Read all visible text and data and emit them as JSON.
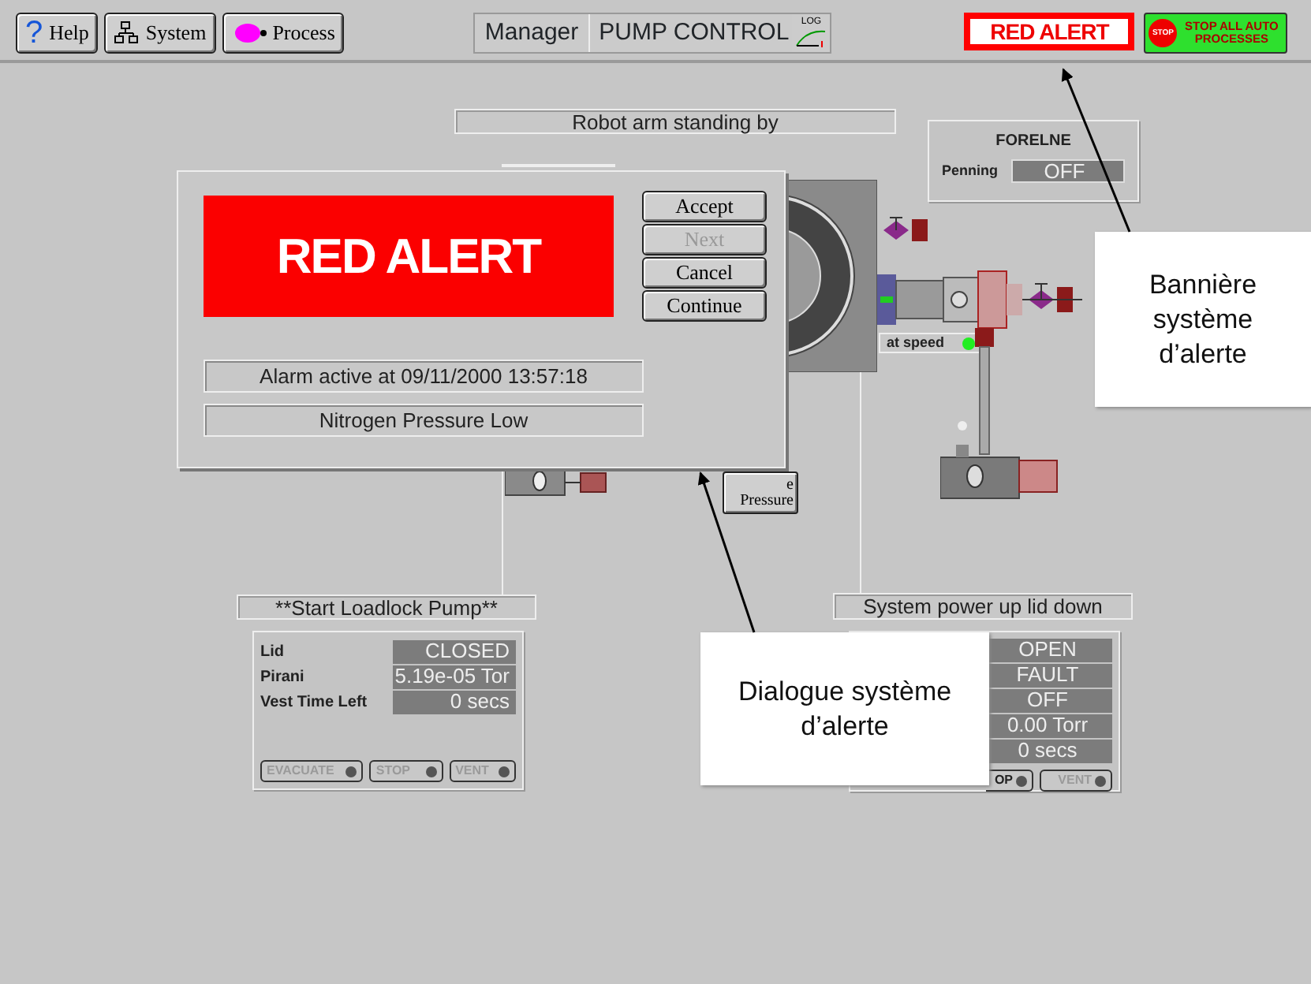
{
  "toolbar": {
    "buttons": [
      {
        "kind": "help",
        "icon_text": "?",
        "label": "Help"
      },
      {
        "kind": "system",
        "label": "System"
      },
      {
        "kind": "process",
        "label": "Process"
      }
    ],
    "manager": {
      "user": "Manager",
      "screen": "PUMP CONTROL",
      "log_label": "LOG"
    },
    "alert_banner": {
      "text": "RED ALERT",
      "active": true
    },
    "stop_button": {
      "icon_text": "STOP",
      "label": "STOP ALL AUTO PROCESSES"
    }
  },
  "canvas": {
    "status": "Robot arm standing by",
    "foreline": {
      "title": "FORELNE",
      "rows": [
        {
          "label": "Penning",
          "value": "OFF"
        }
      ]
    },
    "turbo": {
      "label": "at speed",
      "on": true
    },
    "pressure_button": {
      "lines": [
        "e",
        "Pressure"
      ]
    },
    "loadlock": {
      "title": "**Start Loadlock Pump**",
      "rows": [
        {
          "label": "Lid",
          "value": "CLOSED"
        },
        {
          "label": "Pirani",
          "value": "5.19e-05 Tor"
        },
        {
          "label": "Vest Time Left",
          "value": "0 secs"
        }
      ],
      "buttons": [
        {
          "label": "EVACUATE",
          "disabled": true
        },
        {
          "label": "STOP",
          "disabled": true
        },
        {
          "label": "VENT",
          "disabled": true
        }
      ]
    },
    "chamber": {
      "title": "System power up lid down",
      "values": [
        "OPEN",
        "FAULT",
        "OFF",
        "0.00 Torr",
        "0 secs"
      ],
      "buttons": [
        {
          "label": "OP",
          "disabled": false
        },
        {
          "label": "VENT",
          "disabled": true
        }
      ]
    }
  },
  "alarm_dialog": {
    "banner": "RED ALERT",
    "buttons": [
      {
        "label": "Accept",
        "disabled": false
      },
      {
        "label": "Next",
        "disabled": true
      },
      {
        "label": "Cancel",
        "disabled": false
      },
      {
        "label": "Continue",
        "disabled": false
      }
    ],
    "time": "Alarm active at 09/11/2000 13:57:18",
    "message": "Nitrogen Pressure Low"
  },
  "callouts": [
    {
      "text": "Bannière système d’alerte"
    },
    {
      "text": "Dialogue système d’alerte"
    }
  ]
}
